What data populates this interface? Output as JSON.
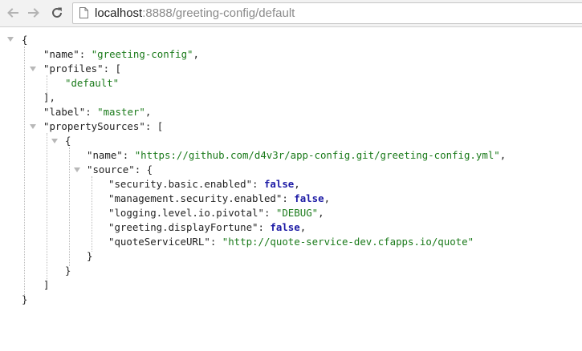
{
  "browser": {
    "url_host": "localhost",
    "url_rest": ":8888/greeting-config/default"
  },
  "json": {
    "open_brace": "{",
    "close_brace": "}",
    "name_key": "\"name\"",
    "name_value": "\"greeting-config\"",
    "profiles_key": "\"profiles\"",
    "profiles_item": "\"default\"",
    "label_key": "\"label\"",
    "label_value": "\"master\"",
    "property_sources_key": "\"propertySources\"",
    "ps_name_key": "\"name\"",
    "ps_name_value": "\"https://github.com/d4v3r/app-config.git/greeting-config.yml\"",
    "source_key": "\"source\"",
    "entries": [
      {
        "key": "\"security.basic.enabled\"",
        "value": "false"
      },
      {
        "key": "\"management.security.enabled\"",
        "value": "false"
      },
      {
        "key": "\"logging.level.io.pivotal\"",
        "value": "\"DEBUG\""
      },
      {
        "key": "\"greeting.displayFortune\"",
        "value": "false"
      },
      {
        "key": "\"quoteServiceURL\"",
        "value": "\"http://quote-service-dev.cfapps.io/quote\""
      }
    ]
  }
}
